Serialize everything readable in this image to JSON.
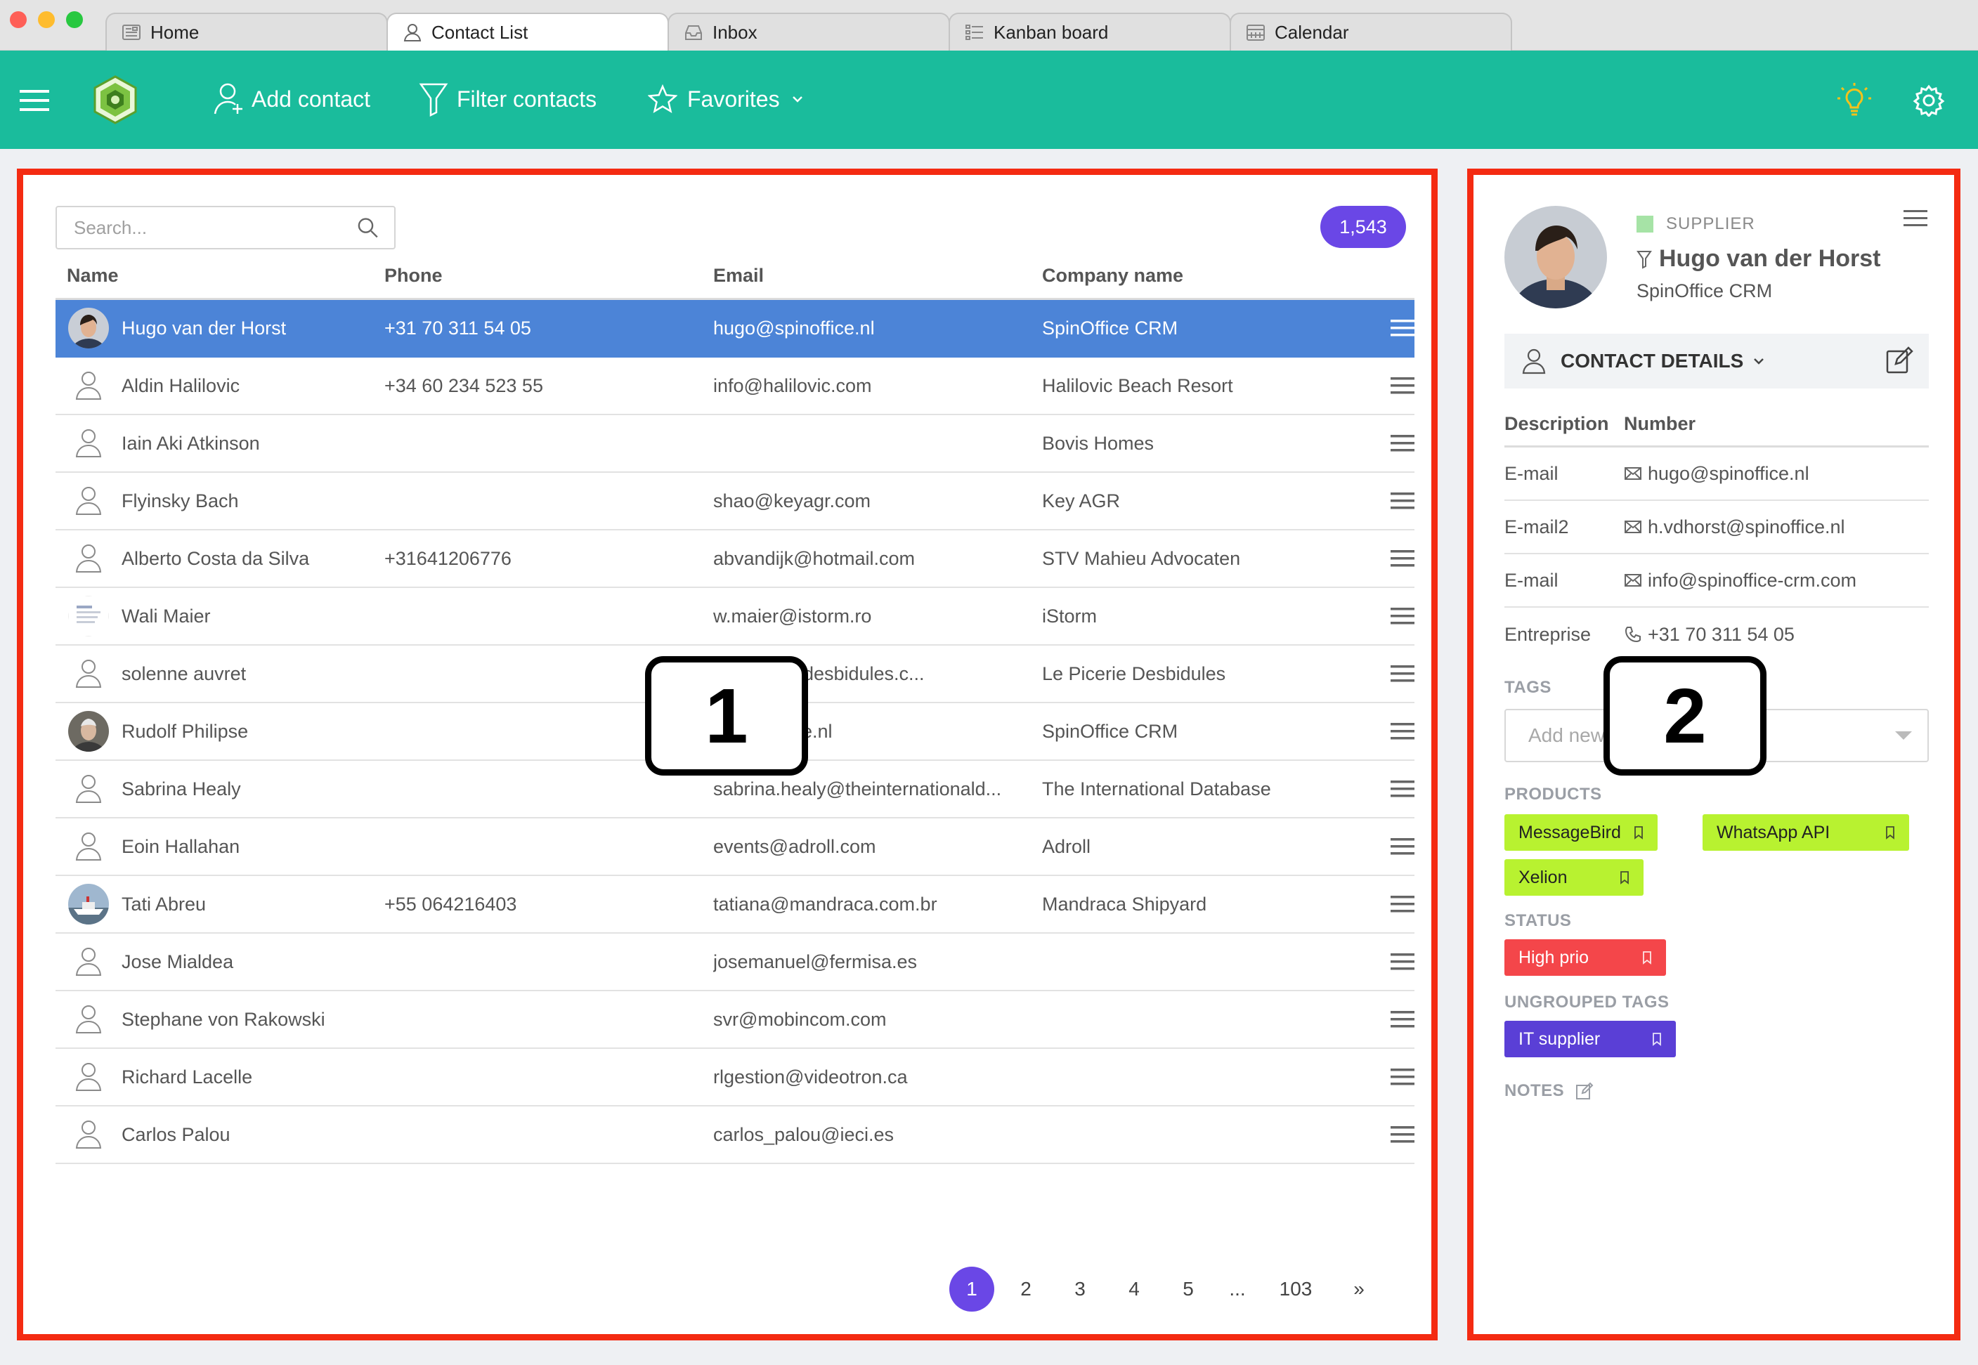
{
  "browser": {
    "tabs": [
      {
        "label": "Home",
        "icon": "newspaper-icon"
      },
      {
        "label": "Contact List",
        "icon": "user-icon",
        "active": true
      },
      {
        "label": "Inbox",
        "icon": "inbox-icon"
      },
      {
        "label": "Kanban board",
        "icon": "list-icon"
      },
      {
        "label": "Calendar",
        "icon": "calendar-icon"
      }
    ]
  },
  "toolbar": {
    "add_contact": "Add contact",
    "filter_contacts": "Filter contacts",
    "favorites": "Favorites",
    "accent_color": "#1abc9c"
  },
  "list": {
    "search_placeholder": "Search...",
    "count": "1,543",
    "columns": {
      "name": "Name",
      "phone": "Phone",
      "email": "Email",
      "company": "Company name"
    },
    "rows": [
      {
        "name": "Hugo van der Horst",
        "phone": "+31 70 311 54 05",
        "email": "hugo@spinoffice.nl",
        "company": "SpinOffice CRM",
        "avatar": "photo-hugo",
        "selected": true
      },
      {
        "name": "Aldin Halilovic",
        "phone": "+34 60 234 523 55",
        "email": "info@halilovic.com",
        "company": "Halilovic Beach Resort",
        "avatar": "user-icon"
      },
      {
        "name": "Iain Aki Atkinson",
        "phone": "",
        "email": "",
        "company": "Bovis Homes",
        "avatar": "user-icon"
      },
      {
        "name": "Flyinsky Bach",
        "phone": "",
        "email": "shao@keyagr.com",
        "company": "Key AGR",
        "avatar": "user-icon"
      },
      {
        "name": "Alberto Costa da Silva",
        "phone": "+31641206776",
        "email": "abvandijk@hotmail.com",
        "company": "STV Mahieu Advocaten",
        "avatar": "user-icon"
      },
      {
        "name": "Wali Maier",
        "phone": "",
        "email": "w.maier@istorm.ro",
        "company": "iStorm",
        "avatar": "photo-document"
      },
      {
        "name": "solenne auvret",
        "phone": "",
        "email": "@lepiceriedesbidules.c...",
        "company": "Le Picerie Desbidules",
        "avatar": "user-icon"
      },
      {
        "name": "Rudolf Philipse",
        "phone": "",
        "email": "@spinoffice.nl",
        "company": "SpinOffice CRM",
        "avatar": "photo-rudolf"
      },
      {
        "name": "Sabrina Healy",
        "phone": "",
        "email": "sabrina.healy@theinternationald...",
        "company": "The International Database",
        "avatar": "user-icon"
      },
      {
        "name": "Eoin Hallahan",
        "phone": "",
        "email": "events@adroll.com",
        "company": "Adroll",
        "avatar": "user-icon"
      },
      {
        "name": "Tati Abreu",
        "phone": "+55 064216403",
        "email": "tatiana@mandraca.com.br",
        "company": "Mandraca Shipyard",
        "avatar": "photo-ship"
      },
      {
        "name": "Jose Mialdea",
        "phone": "",
        "email": "josemanuel@fermisa.es",
        "company": "",
        "avatar": "user-icon"
      },
      {
        "name": "Stephane von Rakowski",
        "phone": "",
        "email": "svr@mobincom.com",
        "company": "",
        "avatar": "user-icon"
      },
      {
        "name": "Richard Lacelle",
        "phone": "",
        "email": "rlgestion@videotron.ca",
        "company": "",
        "avatar": "user-icon"
      },
      {
        "name": "Carlos Palou",
        "phone": "",
        "email": "carlos_palou@ieci.es",
        "company": "",
        "avatar": "user-icon"
      }
    ],
    "pagination": [
      "1",
      "2",
      "3",
      "4",
      "5",
      "...",
      "103",
      "»"
    ],
    "current_page": "1"
  },
  "detail": {
    "type_tag": "SUPPLIER",
    "name": "Hugo van der Horst",
    "company": "SpinOffice CRM",
    "section_title": "CONTACT DETAILS",
    "columns": {
      "description": "Description",
      "number": "Number"
    },
    "rows": [
      {
        "description": "E-mail",
        "icon": "mail-icon",
        "value": "hugo@spinoffice.nl"
      },
      {
        "description": "E-mail2",
        "icon": "mail-icon",
        "value": "h.vdhorst@spinoffice.nl"
      },
      {
        "description": "E-mail",
        "icon": "mail-icon",
        "value": "info@spinoffice-crm.com"
      },
      {
        "description": "Entreprise",
        "icon": "phone-icon",
        "value": "+31 70 311 54 05"
      }
    ],
    "tags_label": "TAGS",
    "tags_placeholder": "Add new",
    "products_label": "PRODUCTS",
    "products": [
      "MessageBird",
      "WhatsApp API",
      "Xelion"
    ],
    "status_label": "STATUS",
    "status": [
      "High prio"
    ],
    "ungrouped_label": "UNGROUPED TAGS",
    "ungrouped": [
      "IT supplier"
    ],
    "notes_label": "NOTES",
    "colors": {
      "product_chip": "#b8f230",
      "status_chip": "#f4464a",
      "ungrouped_chip": "#5a3fd6",
      "supplier": "#a6e3a6"
    }
  },
  "callouts": [
    "1",
    "2"
  ]
}
